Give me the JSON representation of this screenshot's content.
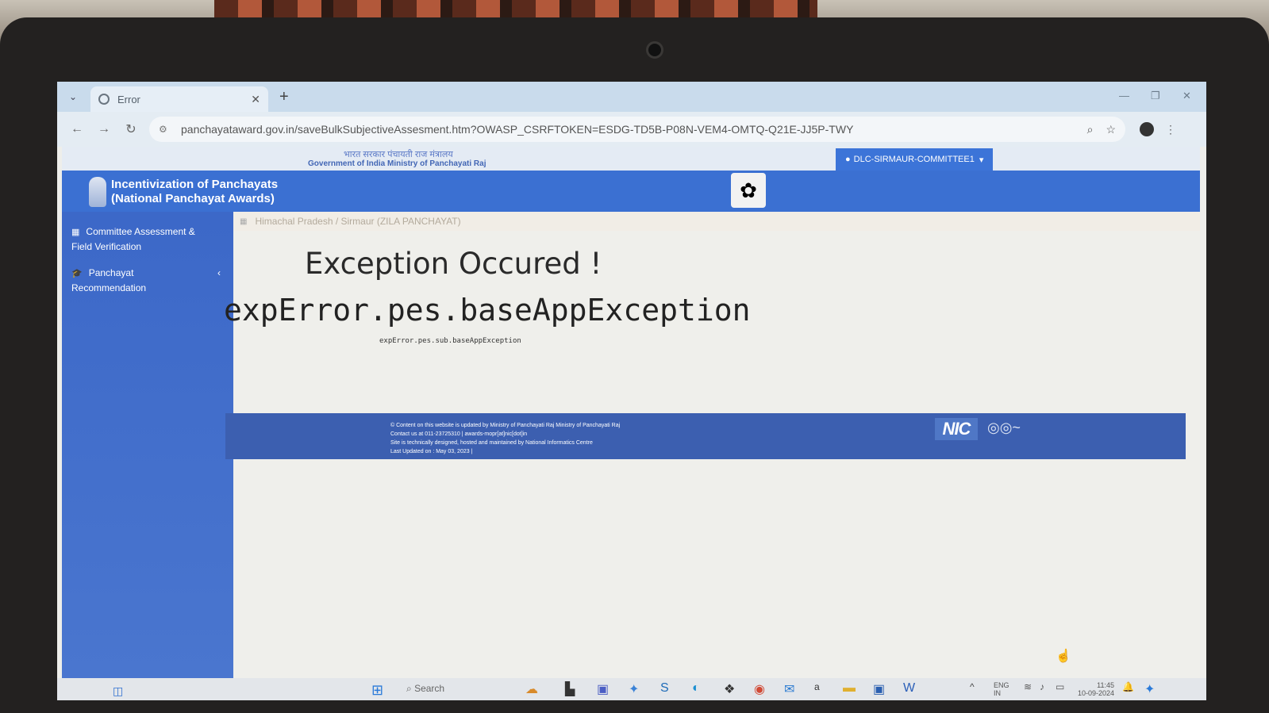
{
  "browser": {
    "tab_title": "Error",
    "new_tab": "+",
    "url": "panchayataward.gov.in/saveBulkSubjectiveAssesment.htm?OWASP_CSRFTOKEN=ESDG-TD5B-P08N-VEM4-OMTQ-Q21E-JJ5P-TWY"
  },
  "site": {
    "gov_hindi": "भारत सरकार  पंचायती राज मंत्रालय",
    "gov_english": "Government of India  Ministry of Panchayati Raj",
    "title_line1": "Incentivization of Panchayats",
    "title_line2": "(National Panchayat Awards)",
    "user_menu": "DLC-SIRMAUR-COMMITTEE1"
  },
  "sidebar": {
    "items": [
      {
        "label": "Committee Assessment & Field Verification"
      },
      {
        "label": "Panchayat Recommendation"
      }
    ]
  },
  "breadcrumb": "Himachal Pradesh / Sirmaur (ZILA PANCHAYAT)",
  "error": {
    "title": "Exception Occured !",
    "code": "expError.pes.baseAppException",
    "detail": "expError.pes.sub.baseAppException"
  },
  "footer": {
    "line1": "© Content on this website is updated by Ministry of Panchayati Raj Ministry of Panchayati Raj",
    "line2": "Contact us at 011-23725310 | awards-mopr[at]nic[dot]in",
    "line3": "Site is technically designed, hosted and maintained by National Informatics Centre",
    "line4": "Last Updated on : May 03, 2023 |",
    "nic_logo": "NIC"
  },
  "taskbar": {
    "search_placeholder": "Search",
    "lang_line1": "ENG",
    "lang_line2": "IN",
    "time": "11:45",
    "date": "10-09-2024"
  }
}
